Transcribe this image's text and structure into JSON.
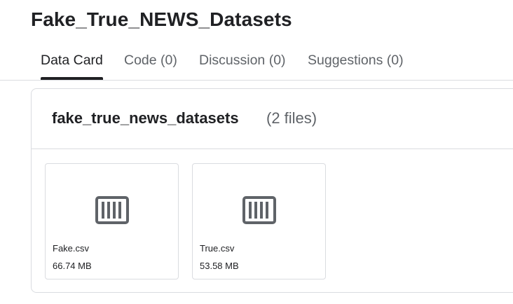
{
  "page": {
    "title": "Fake_True_NEWS_Datasets"
  },
  "tabs": [
    {
      "label": "Data Card",
      "active": true
    },
    {
      "label": "Code (0)",
      "active": false
    },
    {
      "label": "Discussion (0)",
      "active": false
    },
    {
      "label": "Suggestions (0)",
      "active": false
    }
  ],
  "dataset": {
    "name": "fake_true_news_datasets",
    "file_count": "(2 files)",
    "files": [
      {
        "name": "Fake.csv",
        "size": "66.74 MB",
        "icon": "table-icon"
      },
      {
        "name": "True.csv",
        "size": "53.58 MB",
        "icon": "table-icon"
      }
    ]
  },
  "colors": {
    "text": "#202124",
    "muted": "#5f6368",
    "border": "#dadce0",
    "icon": "#5f6368"
  }
}
